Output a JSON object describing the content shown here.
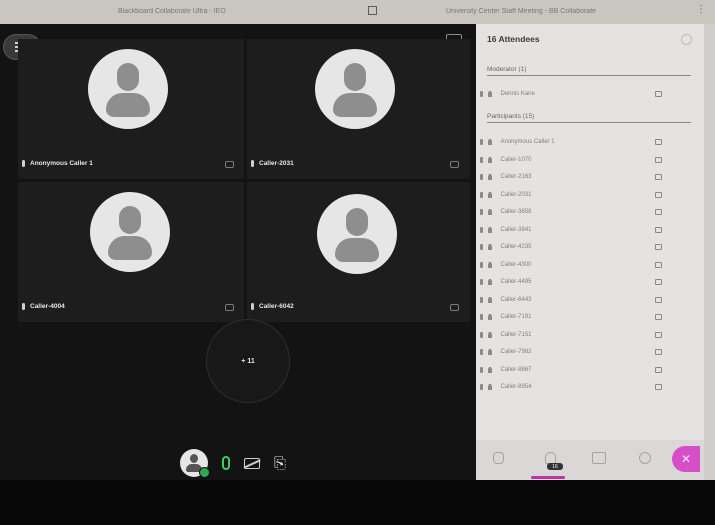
{
  "browser": {
    "tab1_title": "Blackboard Collaborate Ultra - IEO",
    "tab2_title": "University Center Staff Meeting - BB Collaborate"
  },
  "tiles": [
    {
      "name": "Anonymous Caller 1"
    },
    {
      "name": "Caller-2031"
    },
    {
      "name": "Caller-4004"
    },
    {
      "name": "Caller-6042"
    }
  ],
  "overflow_label": "+ 11",
  "panel": {
    "title": "16 Attendees",
    "moderators_heading": "Moderator (1)",
    "moderators": [
      "Dennis Kane"
    ],
    "participants_heading": "Participants (15)",
    "participants": [
      "Anonymous Caller 1",
      "Caller-1070",
      "Caller-2163",
      "Caller-2031",
      "Caller-3858",
      "Caller-3841",
      "Caller-4235",
      "Caller-4300",
      "Caller-4495",
      "Caller-6443",
      "Caller-7191",
      "Caller-7151",
      "Caller-7982",
      "Caller-8867",
      "Caller-8954"
    ],
    "footer_badge": "16",
    "close_symbol": "✕"
  },
  "colors": {
    "accent": "#d64fc7",
    "mic_on": "#3ccf5c",
    "presence": "#2fa84f"
  },
  "icons": [
    "menu-icon",
    "chat-icon",
    "mic-icon",
    "captions-icon",
    "camera-off-icon",
    "share-content-icon",
    "people-icon",
    "settings-icon",
    "close-icon"
  ]
}
